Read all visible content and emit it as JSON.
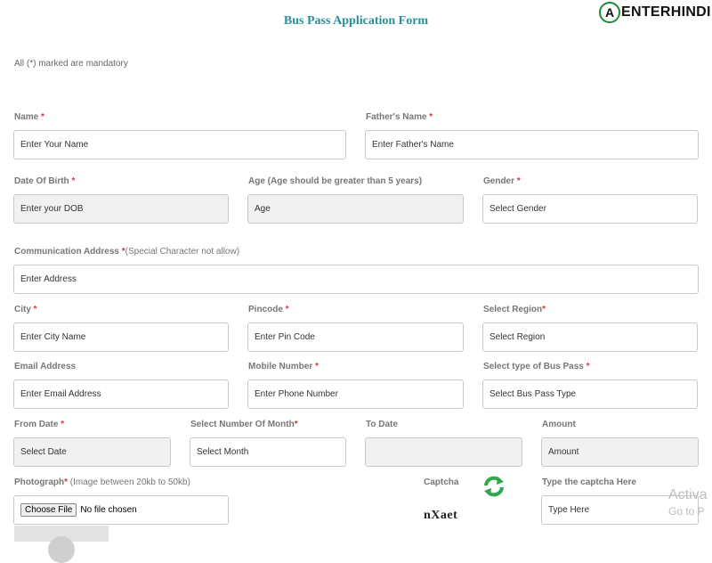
{
  "header": {
    "title": "Bus Pass Application Form",
    "logo_mark": "A",
    "logo_text": "ENTERHINDI",
    "mandatory_note": "All (*) marked are mandatory"
  },
  "form": {
    "name": {
      "label": "Name",
      "req": " *",
      "placeholder": "Enter Your Name"
    },
    "father_name": {
      "label": "Father's Name",
      "req": " *",
      "placeholder": "Enter Father's Name"
    },
    "dob": {
      "label": "Date Of Birth",
      "req": " *",
      "placeholder": "Enter your DOB"
    },
    "age": {
      "label": "Age (Age should be greater than 5 years)",
      "placeholder": "Age"
    },
    "gender": {
      "label": "Gender",
      "req": " *",
      "selected": "Select Gender"
    },
    "address": {
      "label": "Communication Address",
      "req": " *",
      "sub": "(Special Character not allow)",
      "placeholder": "Enter Address"
    },
    "city": {
      "label": "City",
      "req": " *",
      "placeholder": "Enter City Name"
    },
    "pincode": {
      "label": "Pincode",
      "req": " *",
      "placeholder": "Enter Pin Code"
    },
    "region": {
      "label": "Select Region",
      "req": "*",
      "selected": "Select Region"
    },
    "email": {
      "label": "Email Address",
      "placeholder": "Enter Email Address"
    },
    "mobile": {
      "label": "Mobile Number",
      "req": " *",
      "placeholder": "Enter Phone Number"
    },
    "pass_type": {
      "label": "Select type of Bus Pass",
      "req": " *",
      "selected": "Select Bus Pass Type"
    },
    "from_date": {
      "label": "From Date",
      "req": " *",
      "placeholder": "Select Date"
    },
    "months": {
      "label": "Select Number Of Month",
      "req": "*",
      "selected": "Select Month"
    },
    "to_date": {
      "label": "To Date",
      "value": ""
    },
    "amount": {
      "label": "Amount",
      "placeholder": "Amount"
    },
    "photo": {
      "label": "Photograph",
      "req": "*",
      "sub": " (Image between 20kb to 50kb)",
      "button": "Choose File",
      "status": "No file chosen"
    },
    "captcha": {
      "label": "Captcha",
      "code": "nXaet",
      "refresh_icon": "refresh-icon"
    },
    "captcha_input": {
      "label": "Type the captcha Here",
      "placeholder": "Type Here"
    }
  },
  "watermark": {
    "line1": "Activa",
    "line2": "Go to P"
  },
  "colors": {
    "title": "#2a8f9a",
    "required": "#d9363e",
    "readonly_bg": "#f1f1f1",
    "logo_green": "#1f8a34"
  }
}
